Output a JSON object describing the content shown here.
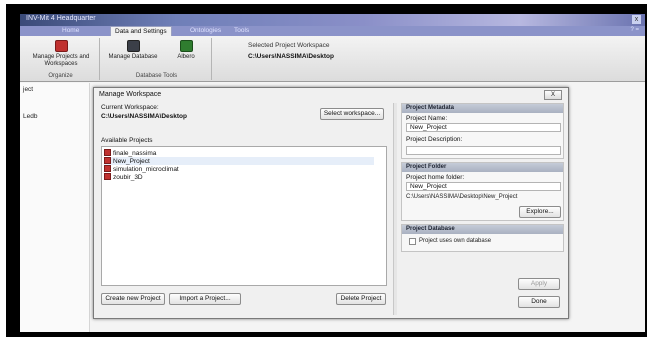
{
  "app": {
    "title": "INV-Mit 4 Headquarter",
    "close_glyph": "x"
  },
  "tabs": [
    {
      "label": "Home"
    },
    {
      "label": "Data and Settings"
    },
    {
      "label": "Ontologies"
    },
    {
      "label": "Tools"
    }
  ],
  "tab_icons": "? =",
  "ribbon": {
    "manage_projects": "Manage Projects and Workspaces",
    "organize": "Organize",
    "manage_database": "Manage Database",
    "albero": "Albero",
    "database_tools": "Database Tools",
    "workspace_label": "Selected Project Workspace",
    "workspace_path": "C:\\Users\\NASSIMA\\Desktop"
  },
  "background": {
    "items": [
      "ject",
      "Ledb"
    ]
  },
  "dialog": {
    "title": "Manage Workspace",
    "close_label": "X",
    "current_workspace_label": "Current Workspace:",
    "current_workspace_path": "C:\\Users\\NASSIMA\\Desktop",
    "select_workspace": "Select workspace...",
    "available_projects_label": "Available Projects",
    "projects": [
      {
        "name": "finale_nassima",
        "selected": false
      },
      {
        "name": "New_Project",
        "selected": true
      },
      {
        "name": "simulation_microclimat",
        "selected": false
      },
      {
        "name": "zoubir_3D",
        "selected": false
      }
    ],
    "create_new_project": "Create new Project",
    "import_project": "Import a Project...",
    "delete_project": "Delete Project",
    "metadata": {
      "header": "Project Metadata",
      "name_label": "Project Name:",
      "name_value": "New_Project",
      "description_label": "Project Description:",
      "description_value": ""
    },
    "folder": {
      "header": "Project Folder",
      "home_label": "Project home folder:",
      "home_value": "New_Project",
      "full_path": "C:\\Users\\NASSIMA\\Desktop\\New_Project",
      "explore": "Explore..."
    },
    "database": {
      "header": "Project Database",
      "own_db_label": "Project uses own database",
      "own_db_checked": false
    },
    "apply": "Apply",
    "done": "Done"
  }
}
